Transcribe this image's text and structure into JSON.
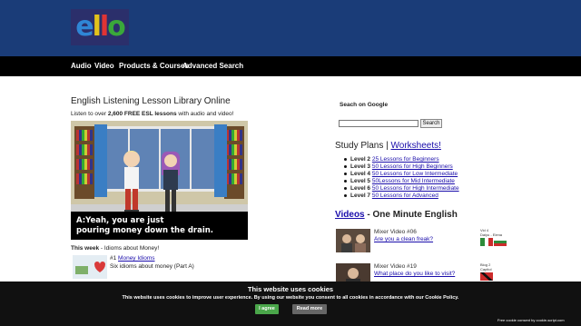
{
  "brand": {
    "logo_letters": [
      {
        "char": "e",
        "color": "#2f86d6"
      },
      {
        "char": "l",
        "color": "#e2c21b"
      },
      {
        "char": "l",
        "color": "#e03434"
      },
      {
        "char": "o",
        "color": "#3aa83a"
      }
    ],
    "topbar_color": "#1a3c78"
  },
  "nav": {
    "items": [
      "Audio",
      "Video",
      "Products & Courses",
      "Advanced Search"
    ]
  },
  "main": {
    "title": "English Listening Lesson Library Online",
    "intro_prefix": "Listen to over ",
    "intro_bold": "2,600 FREE ESL lessons",
    "intro_suffix": " with audio and video!",
    "video": {
      "subtitle_line1": "A:Yeah, you are just",
      "subtitle_line2": "pouring money down the drain."
    },
    "this_week": {
      "label": "This week",
      "text": " - Idioms about Money!"
    },
    "lesson": {
      "number": "#1 ",
      "title": "Money Idioms",
      "subtitle": "Six idioms about money (Part A)"
    }
  },
  "sidebar": {
    "search_label": "Seach on Google",
    "search_value": "",
    "search_button": "Search",
    "study_plans_label": "Study Plans | ",
    "worksheets_link": "Worksheets!",
    "plans": [
      {
        "level": "Level 2",
        "link": "25 Lessons for Beginners"
      },
      {
        "level": "Level 3",
        "link": "50 Lessons for High Beginners"
      },
      {
        "level": "Level 4",
        "link": "50 Lessons for Low Intermediate"
      },
      {
        "level": "Level 5",
        "link": "50Lessons for Mid Intermediate"
      },
      {
        "level": "Level 6",
        "link": "50 Lessons for High Intermediate"
      },
      {
        "level": "Level 7",
        "link": "50 Lessons for Advanced"
      }
    ],
    "videos_link": "Videos",
    "videos_suffix": " - One Minute English",
    "videos": [
      {
        "title": "Mixer Video #06",
        "question": "Are you a clean freak?",
        "mini_line1": "Vid 4",
        "mini_line2": "Daiyu - Elena"
      },
      {
        "title": "Mixer Video #19",
        "question": "What place do you like to visit?",
        "mini_line1": "Blog 2",
        "mini_line2": "Capitol"
      }
    ]
  },
  "cookie": {
    "title": "This website uses cookies",
    "text": "This website uses cookies to improve user experience. By using our website you consent to all cookies in accordance with our Cookie Policy.",
    "agree_button": "I agree",
    "read_more_button": "Read more",
    "credit": "Free cookie consent by cookie-script.com"
  }
}
